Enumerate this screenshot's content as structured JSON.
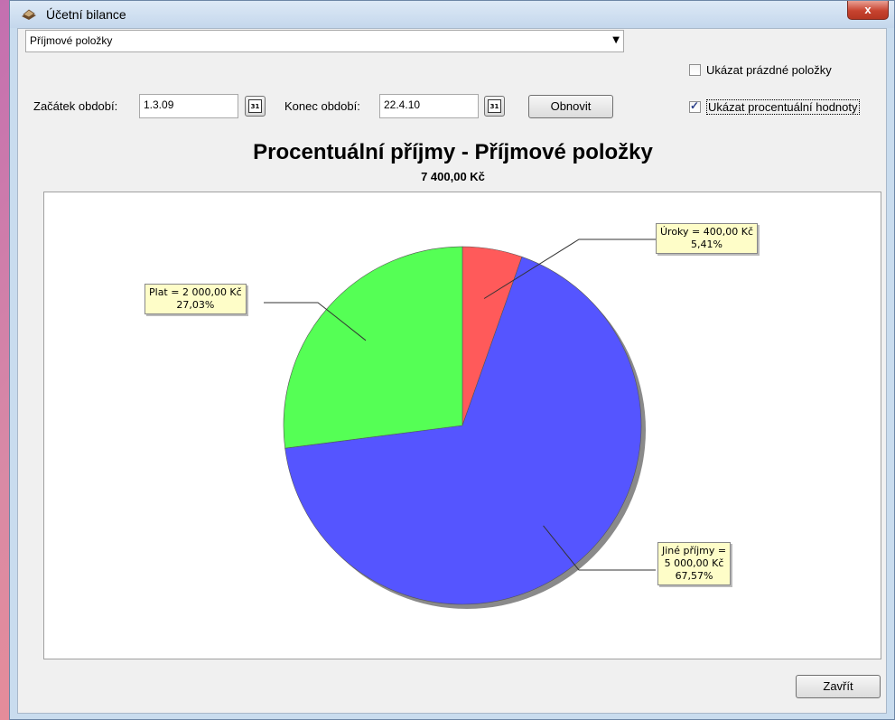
{
  "window": {
    "title": "Účetní bilance",
    "close_label": "x"
  },
  "filter": {
    "category_selected": "Příjmové položky",
    "show_empty_label": "Ukázat prázdné položky",
    "show_empty_checked": false,
    "show_percent_label": "Ukázat procentuální hodnoty",
    "show_percent_checked": true
  },
  "period": {
    "start_label": "Začátek období:",
    "start_value": "1.3.09",
    "end_label": "Konec období:",
    "end_value": "22.4.10",
    "calendar_day": "31",
    "refresh_label": "Obnovit"
  },
  "chart_data": {
    "type": "pie",
    "title": "Procentuální příjmy - Příjmové položky",
    "subtitle": "7 400,00 Kč",
    "slices": [
      {
        "name": "Úroky",
        "label_line1": "Úroky = 400,00 Kč",
        "label_line2": "5,41%",
        "value": 400,
        "percent": 5.41,
        "color": "#ff5a5a"
      },
      {
        "name": "Jiné příjmy",
        "label_line1": "Jiné příjmy =",
        "label_line2": "5 000,00 Kč",
        "label_line3": "67,57%",
        "value": 5000,
        "percent": 67.57,
        "color": "#5555ff"
      },
      {
        "name": "Plat",
        "label_line1": "Plat = 2 000,00 Kč",
        "label_line2": "27,03%",
        "value": 2000,
        "percent": 27.03,
        "color": "#55ff55"
      }
    ]
  },
  "footer": {
    "close_button_label": "Zavřít"
  }
}
